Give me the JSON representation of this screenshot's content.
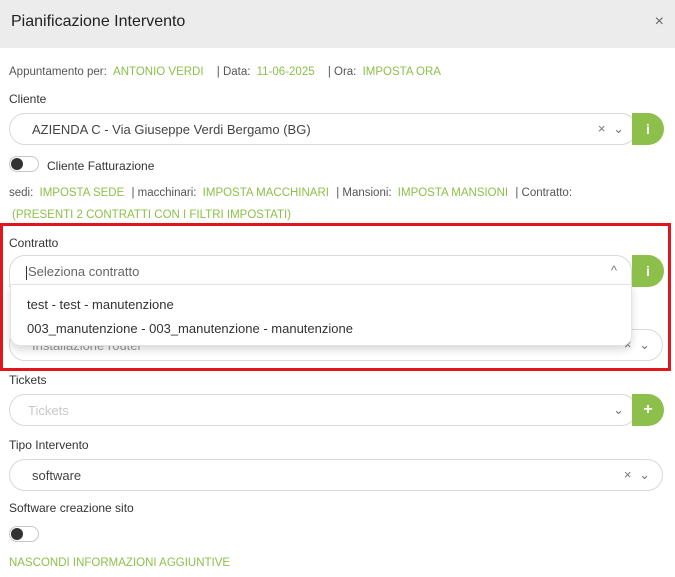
{
  "dialog": {
    "title": "Pianificazione Intervento",
    "close_glyph": "×"
  },
  "info_line": {
    "appointment_label": "Appuntamento per:",
    "appointment_value": "ANTONIO VERDI",
    "date_label": "| Data:",
    "date_value": "11-06-2025",
    "time_label": "| Ora:",
    "time_value": "IMPOSTA ORA"
  },
  "cliente": {
    "label": "Cliente",
    "value": "AZIENDA C - Via Giuseppe Verdi Bergamo (BG)",
    "clear_glyph": "×",
    "chevron_glyph": "⌄",
    "info_glyph": "i"
  },
  "cliente_fatturazione": {
    "label": "Cliente Fatturazione",
    "checked": false
  },
  "settings_line": {
    "sedi_label": "sedi:",
    "sedi_value": "IMPOSTA SEDE",
    "macchinari_label": "| macchinari:",
    "macchinari_value": "IMPOSTA MACCHINARI",
    "mansioni_label": "| Mansioni:",
    "mansioni_value": "IMPOSTA MANSIONI",
    "contratto_label": "| Contratto:",
    "contratto_value": "(PRESENTI 2 CONTRATTI CON I FILTRI IMPOSTATI)"
  },
  "contratto": {
    "label": "Contratto",
    "placeholder": "Seleziona contratto",
    "chevron_up_glyph": "^",
    "info_glyph": "i",
    "options": [
      "test - test - manutenzione",
      "003_manutenzione - 003_manutenzione - manutenzione"
    ]
  },
  "hidden_field": {
    "value": "Installazione router",
    "clear_glyph": "×",
    "chevron_glyph": "⌄"
  },
  "tickets": {
    "label": "Tickets",
    "placeholder": "Tickets",
    "chevron_glyph": "⌄",
    "add_glyph": "+"
  },
  "tipo_intervento": {
    "label": "Tipo Intervento",
    "value": "software",
    "clear_glyph": "×",
    "chevron_glyph": "⌄"
  },
  "software_creazione_sito": {
    "label": "Software creazione sito",
    "checked": false
  },
  "footer_link": "NASCONDI INFORMAZIONI AGGIUNTIVE",
  "colors": {
    "accent_green": "#8dc04a",
    "highlight_red": "#e0161c",
    "header_bg": "#ececec"
  }
}
